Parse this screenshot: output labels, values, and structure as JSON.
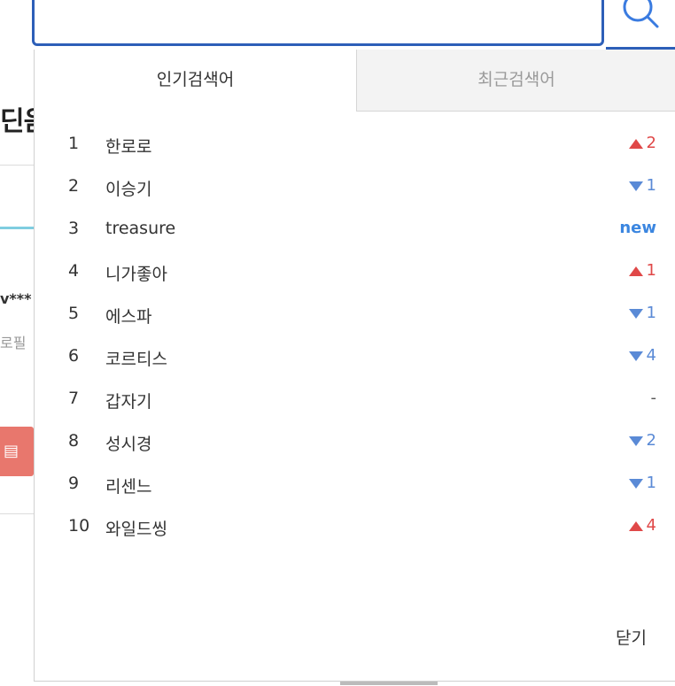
{
  "background": {
    "title_fragment": "딘음",
    "user_fragment": "v***",
    "profile_fragment": "로필"
  },
  "search": {
    "value": "",
    "placeholder": ""
  },
  "tabs": [
    {
      "label": "인기검색어",
      "active": true
    },
    {
      "label": "최근검색어",
      "active": false
    }
  ],
  "popular_keywords": [
    {
      "rank": "1",
      "keyword": "한로로",
      "change_type": "up",
      "change": "2"
    },
    {
      "rank": "2",
      "keyword": "이승기",
      "change_type": "down",
      "change": "1"
    },
    {
      "rank": "3",
      "keyword": "treasure",
      "change_type": "new",
      "change": "new"
    },
    {
      "rank": "4",
      "keyword": "니가좋아",
      "change_type": "up",
      "change": "1"
    },
    {
      "rank": "5",
      "keyword": "에스파",
      "change_type": "down",
      "change": "1"
    },
    {
      "rank": "6",
      "keyword": "코르티스",
      "change_type": "down",
      "change": "4"
    },
    {
      "rank": "7",
      "keyword": "갑자기",
      "change_type": "same",
      "change": "-"
    },
    {
      "rank": "8",
      "keyword": "성시경",
      "change_type": "down",
      "change": "2"
    },
    {
      "rank": "9",
      "keyword": "리센느",
      "change_type": "down",
      "change": "1"
    },
    {
      "rank": "10",
      "keyword": "와일드씽",
      "change_type": "up",
      "change": "4"
    }
  ],
  "close_label": "닫기",
  "colors": {
    "search_border": "#2d5fb8",
    "up": "#e04848",
    "down": "#5a8ad6",
    "new": "#3b86e0"
  }
}
